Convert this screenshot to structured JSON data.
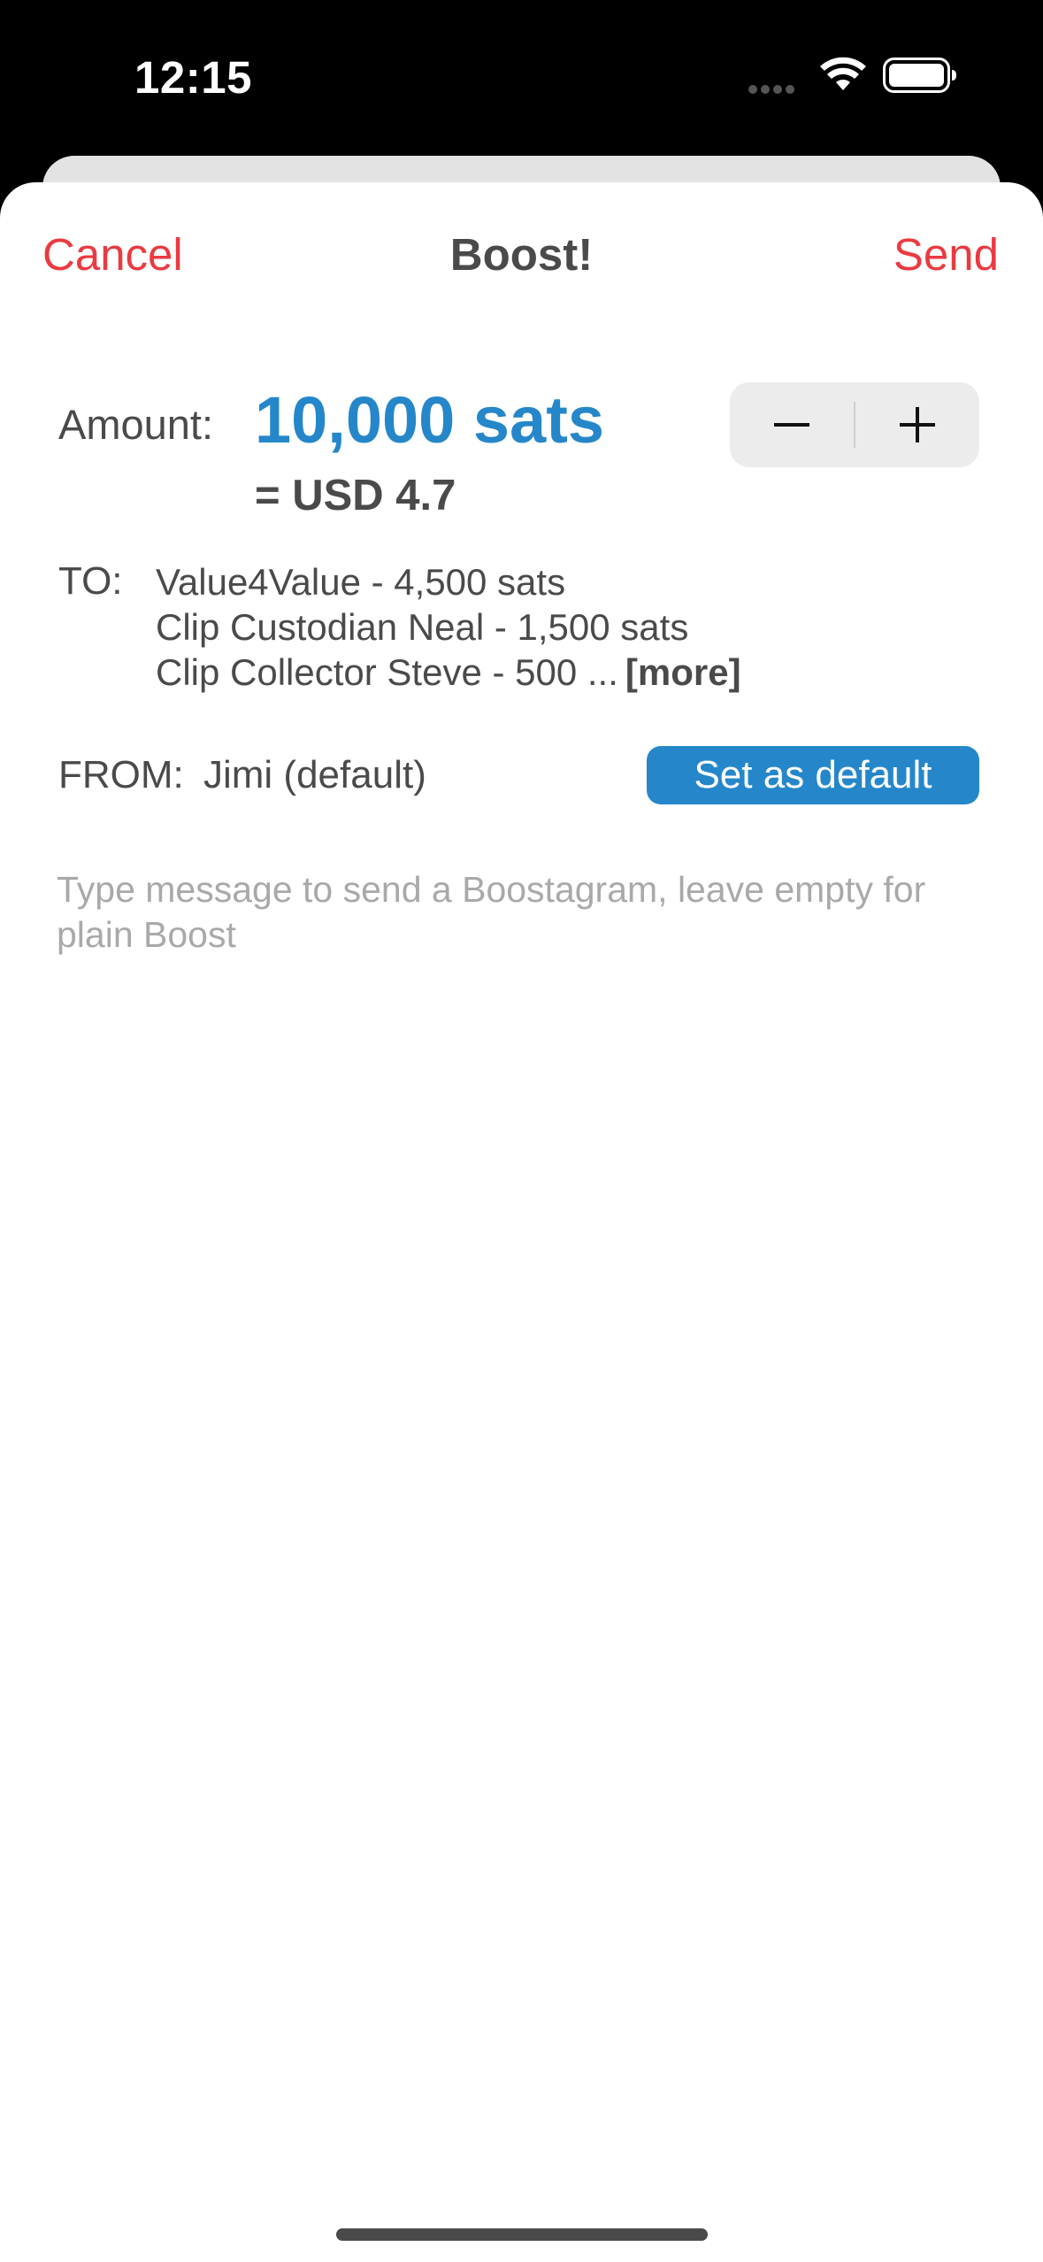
{
  "status_bar": {
    "time": "12:15"
  },
  "nav": {
    "cancel": "Cancel",
    "title": "Boost!",
    "send": "Send"
  },
  "amount": {
    "label": "Amount:",
    "value": "10,000 sats",
    "fiat": "= USD 4.7"
  },
  "stepper": {
    "minus": "−",
    "plus": "+"
  },
  "to": {
    "label": "TO:",
    "recipients": [
      "Value4Value - 4,500 sats",
      "Clip Custodian Neal - 1,500 sats",
      "Clip Collector Steve - 500 ..."
    ],
    "more": "[more]"
  },
  "from": {
    "label": "FROM:",
    "value": "Jimi (default)",
    "button": "Set as default"
  },
  "message": {
    "placeholder": "Type message to send a Boostagram, leave empty for plain Boost"
  },
  "colors": {
    "accent_red": "#ea3a41",
    "accent_blue": "#2587c9",
    "text": "#4a4a4a"
  }
}
